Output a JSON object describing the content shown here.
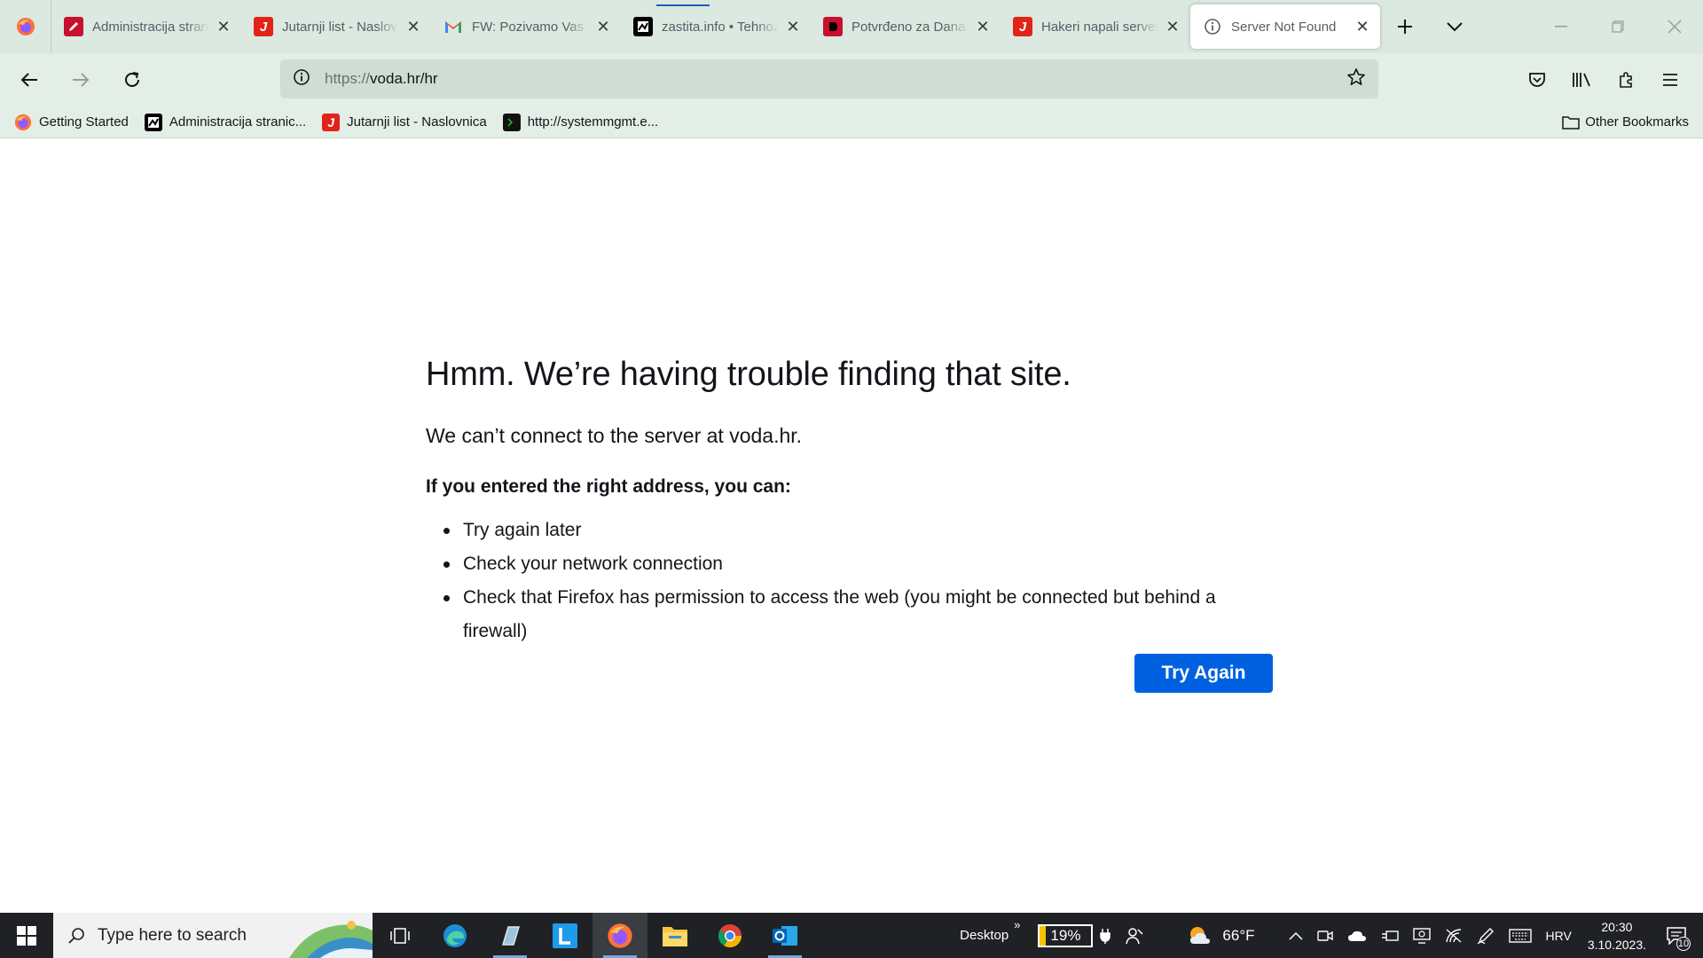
{
  "browser": {
    "tabs": [
      {
        "title": "Administracija stranica",
        "icon": "red-pen-icon",
        "color": "#c8102e",
        "active": false
      },
      {
        "title": "Jutarnji list - Naslovnica",
        "icon": "jutarnji-j-icon",
        "color": "#e2231a",
        "active": false
      },
      {
        "title": "FW: Pozivamo Vas na",
        "icon": "gmail-icon",
        "color": "#ea4335",
        "active": false
      },
      {
        "title": "zastita.info • Tehnoz",
        "icon": "zastita-icon",
        "color": "#000000",
        "active": false
      },
      {
        "title": "Potvrđeno za Danas",
        "icon": "danas-icon",
        "color": "#c8102e",
        "active": false
      },
      {
        "title": "Hakeri napali server",
        "icon": "jutarnji-j-icon",
        "color": "#e2231a",
        "active": false
      },
      {
        "title": "Server Not Found",
        "icon": "info-icon",
        "color": "#5b5b66",
        "active": true
      }
    ],
    "url": {
      "scheme": "https://",
      "host": "voda.hr/hr"
    },
    "bookmarks": [
      {
        "label": "Getting Started",
        "icon": "firefox-icon"
      },
      {
        "label": "Administracija stranic...",
        "icon": "zastita-icon"
      },
      {
        "label": "Jutarnji list - Naslovnica",
        "icon": "jutarnji-j-icon"
      },
      {
        "label": "http://systemmgmt.e...",
        "icon": "terminal-icon"
      }
    ],
    "other_bookmarks": "Other Bookmarks"
  },
  "error_page": {
    "title": "Hmm. We’re having trouble finding that site.",
    "description": "We can’t connect to the server at voda.hr.",
    "hint": "If you entered the right address, you can:",
    "suggestions": [
      "Try again later",
      "Check your network connection",
      "Check that Firefox has permission to access the web (you might be connected but behind a firewall)"
    ],
    "button": "Try Again",
    "accent_color": "#0061e0"
  },
  "taskbar": {
    "search_placeholder": "Type here to search",
    "desktop_label": "Desktop",
    "battery": "19%",
    "weather": "66°F",
    "language": "HRV",
    "time": "20:30",
    "date": "3.10.2023.",
    "notifications": "10"
  }
}
